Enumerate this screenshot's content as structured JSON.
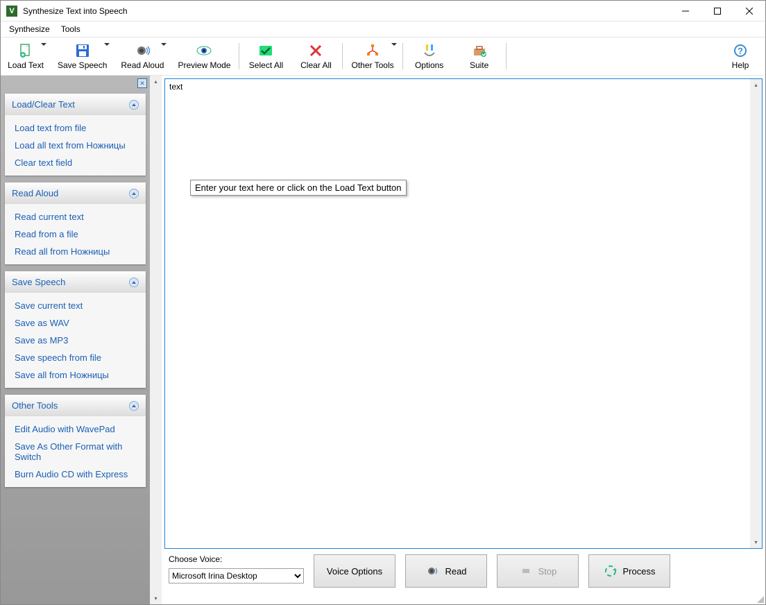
{
  "window": {
    "title": "Synthesize Text into Speech"
  },
  "menubar": {
    "items": [
      "Synthesize",
      "Tools"
    ]
  },
  "toolbar": {
    "load_text": "Load Text",
    "save_speech": "Save Speech",
    "read_aloud": "Read Aloud",
    "preview_mode": "Preview Mode",
    "select_all": "Select All",
    "clear_all": "Clear All",
    "other_tools": "Other Tools",
    "options": "Options",
    "suite": "Suite",
    "help": "Help"
  },
  "sidebar": {
    "panels": {
      "load_clear": {
        "title": "Load/Clear Text",
        "items": [
          "Load text from file",
          "Load all text from Ножницы",
          "Clear text field"
        ]
      },
      "read_aloud": {
        "title": "Read Aloud",
        "items": [
          "Read current text",
          "Read from a file",
          "Read all from Ножницы"
        ]
      },
      "save_speech": {
        "title": "Save Speech",
        "items": [
          "Save current text",
          "Save as WAV",
          "Save as MP3",
          "Save speech from file",
          "Save all from Ножницы"
        ]
      },
      "other_tools": {
        "title": "Other Tools",
        "items": [
          "Edit Audio with WavePad",
          "Save As Other Format with Switch",
          "Burn Audio CD with Express"
        ]
      }
    }
  },
  "editor": {
    "current_text": "text",
    "placeholder_tooltip": "Enter your text here or click on the Load Text button"
  },
  "bottom": {
    "choose_voice_label": "Choose Voice:",
    "selected_voice": "Microsoft Irina Desktop",
    "voice_options": "Voice Options",
    "read": "Read",
    "stop": "Stop",
    "process": "Process"
  }
}
